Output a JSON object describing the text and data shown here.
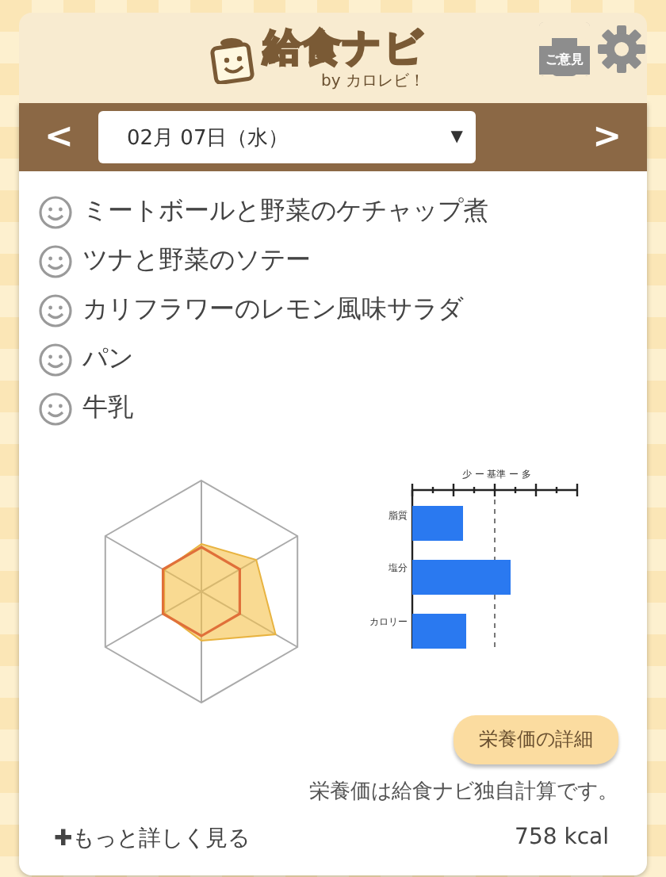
{
  "header": {
    "title": "給食ナビ",
    "byline": "by カロレビ！",
    "feedback_label": "ご意見"
  },
  "date_nav": {
    "prev": "<",
    "next": ">",
    "date": "02月 07日（水）",
    "caret": "▼"
  },
  "menu": [
    {
      "name": "ミートボールと野菜のケチャップ煮"
    },
    {
      "name": "ツナと野菜のソテー"
    },
    {
      "name": "カリフラワーのレモン風味サラダ"
    },
    {
      "name": "パン"
    },
    {
      "name": "牛乳"
    }
  ],
  "bar_chart": {
    "title": "少 ー 基準 ー 多",
    "labels": [
      "脂質",
      "塩分",
      "カロリー"
    ]
  },
  "details_button": "栄養価の詳細",
  "note": "栄養価は給食ナビ独自計算です。",
  "more_link": "✚もっと詳しく見る",
  "calories": "758 kcal"
}
